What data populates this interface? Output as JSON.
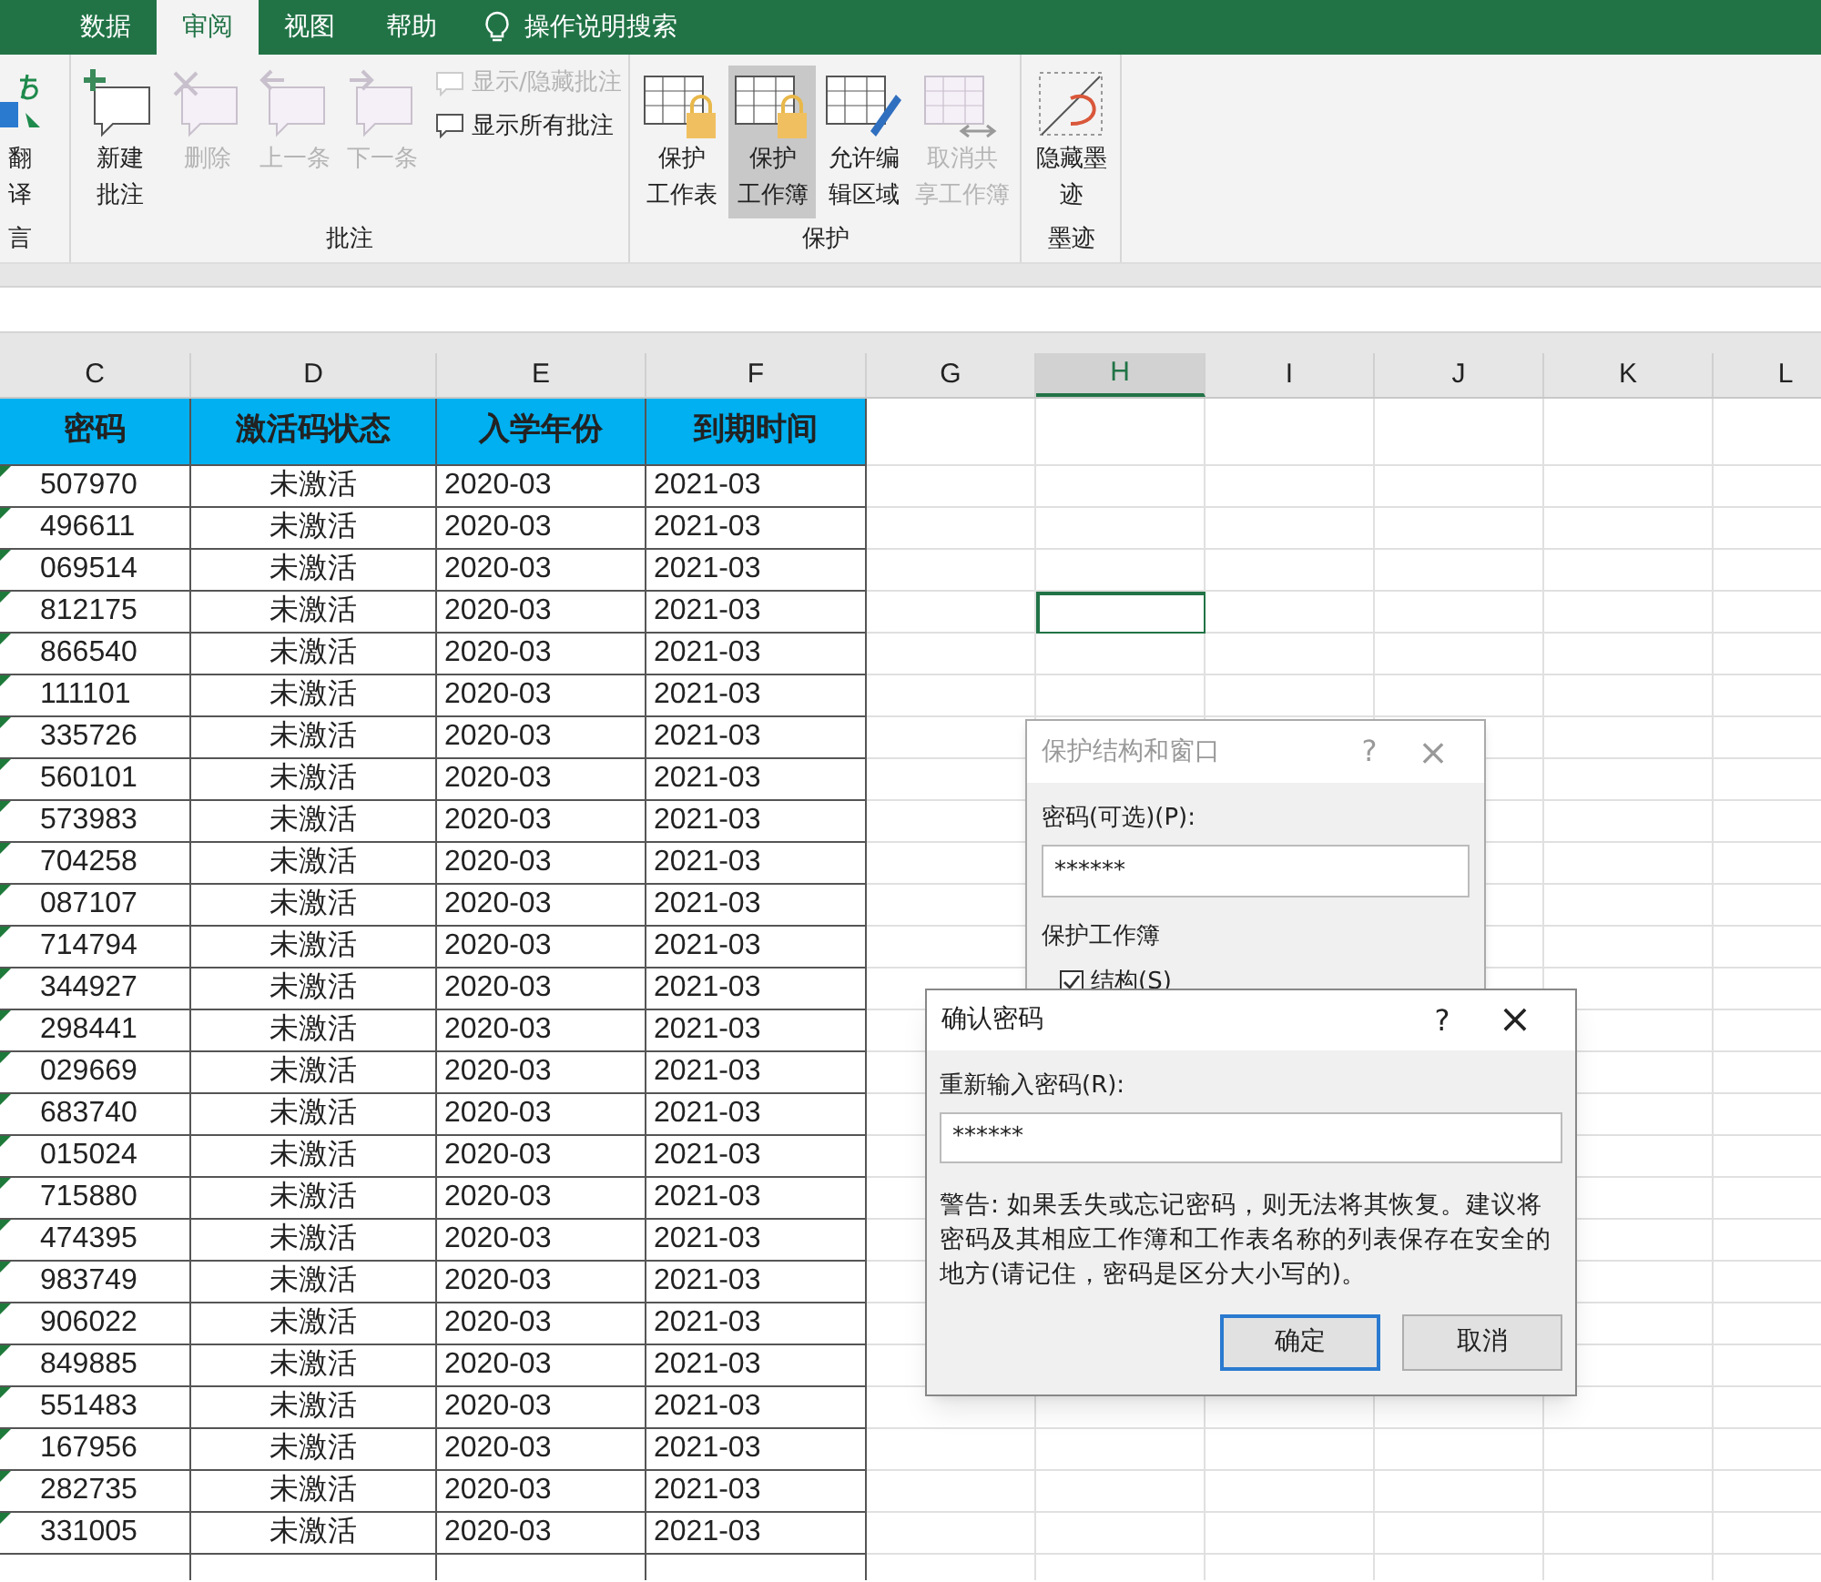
{
  "tabs": [
    {
      "label": "数据",
      "selected": false
    },
    {
      "label": "审阅",
      "selected": true
    },
    {
      "label": "视图",
      "selected": false
    },
    {
      "label": "帮助",
      "selected": false
    }
  ],
  "search": {
    "placeholder": "操作说明搜索"
  },
  "ribbon": {
    "groups": [
      {
        "label": "言",
        "buttons": [
          {
            "kind": "translate",
            "lines": [
              "翻",
              "译"
            ],
            "disabled": false,
            "selected": false
          }
        ]
      },
      {
        "label": "批注",
        "buttons": [
          {
            "kind": "new-comment",
            "lines": [
              "新建",
              "批注"
            ],
            "disabled": false,
            "selected": false
          },
          {
            "kind": "delete-comment",
            "lines": [
              "删除"
            ],
            "disabled": true,
            "selected": false
          },
          {
            "kind": "prev-comment",
            "lines": [
              "上一条"
            ],
            "disabled": true,
            "selected": false
          },
          {
            "kind": "next-comment",
            "lines": [
              "下一条"
            ],
            "disabled": true,
            "selected": false
          }
        ],
        "small_buttons": [
          {
            "label": "显示/隐藏批注",
            "disabled": true
          },
          {
            "label": "显示所有批注",
            "disabled": false
          }
        ]
      },
      {
        "label": "保护",
        "buttons": [
          {
            "kind": "protect-sheet",
            "lines": [
              "保护",
              "工作表"
            ],
            "disabled": false,
            "selected": false
          },
          {
            "kind": "protect-workbook",
            "lines": [
              "保护",
              "工作簿"
            ],
            "disabled": false,
            "selected": true
          },
          {
            "kind": "allow-edit",
            "lines": [
              "允许编",
              "辑区域"
            ],
            "disabled": false,
            "selected": false
          },
          {
            "kind": "unshare",
            "lines": [
              "取消共",
              "享工作簿"
            ],
            "disabled": true,
            "selected": false
          }
        ]
      },
      {
        "label": "墨迹",
        "buttons": [
          {
            "kind": "hide-ink",
            "lines": [
              "隐藏墨",
              "迹"
            ],
            "disabled": false,
            "selected": false
          }
        ]
      }
    ]
  },
  "columns": [
    {
      "label": "C",
      "selected": false
    },
    {
      "label": "D",
      "selected": false
    },
    {
      "label": "E",
      "selected": false
    },
    {
      "label": "F",
      "selected": false
    },
    {
      "label": "G",
      "selected": false
    },
    {
      "label": "H",
      "selected": true
    },
    {
      "label": "I",
      "selected": false
    },
    {
      "label": "J",
      "selected": false
    },
    {
      "label": "K",
      "selected": false
    },
    {
      "label": "L",
      "selected": false
    }
  ],
  "table": {
    "headers": [
      "密码",
      "激活码状态",
      "入学年份",
      "到期时间"
    ],
    "rows": [
      {
        "cells": [
          "507970",
          "未激活",
          "2020-03",
          "2021-03"
        ]
      },
      {
        "cells": [
          "496611",
          "未激活",
          "2020-03",
          "2021-03"
        ]
      },
      {
        "cells": [
          "069514",
          "未激活",
          "2020-03",
          "2021-03"
        ]
      },
      {
        "cells": [
          "812175",
          "未激活",
          "2020-03",
          "2021-03"
        ],
        "active": true
      },
      {
        "cells": [
          "866540",
          "未激活",
          "2020-03",
          "2021-03"
        ]
      },
      {
        "cells": [
          "111101",
          "未激活",
          "2020-03",
          "2021-03"
        ]
      },
      {
        "cells": [
          "335726",
          "未激活",
          "2020-03",
          "2021-03"
        ]
      },
      {
        "cells": [
          "560101",
          "未激活",
          "2020-03",
          "2021-03"
        ]
      },
      {
        "cells": [
          "573983",
          "未激活",
          "2020-03",
          "2021-03"
        ]
      },
      {
        "cells": [
          "704258",
          "未激活",
          "2020-03",
          "2021-03"
        ]
      },
      {
        "cells": [
          "087107",
          "未激活",
          "2020-03",
          "2021-03"
        ]
      },
      {
        "cells": [
          "714794",
          "未激活",
          "2020-03",
          "2021-03"
        ]
      },
      {
        "cells": [
          "344927",
          "未激活",
          "2020-03",
          "2021-03"
        ]
      },
      {
        "cells": [
          "298441",
          "未激活",
          "2020-03",
          "2021-03"
        ]
      },
      {
        "cells": [
          "029669",
          "未激活",
          "2020-03",
          "2021-03"
        ]
      },
      {
        "cells": [
          "683740",
          "未激活",
          "2020-03",
          "2021-03"
        ]
      },
      {
        "cells": [
          "015024",
          "未激活",
          "2020-03",
          "2021-03"
        ]
      },
      {
        "cells": [
          "715880",
          "未激活",
          "2020-03",
          "2021-03"
        ]
      },
      {
        "cells": [
          "474395",
          "未激活",
          "2020-03",
          "2021-03"
        ]
      },
      {
        "cells": [
          "983749",
          "未激活",
          "2020-03",
          "2021-03"
        ]
      },
      {
        "cells": [
          "906022",
          "未激活",
          "2020-03",
          "2021-03"
        ]
      },
      {
        "cells": [
          "849885",
          "未激活",
          "2020-03",
          "2021-03"
        ]
      },
      {
        "cells": [
          "551483",
          "未激活",
          "2020-03",
          "2021-03"
        ]
      },
      {
        "cells": [
          "167956",
          "未激活",
          "2020-03",
          "2021-03"
        ]
      },
      {
        "cells": [
          "282735",
          "未激活",
          "2020-03",
          "2021-03"
        ]
      },
      {
        "cells": [
          "331005",
          "未激活",
          "2020-03",
          "2021-03"
        ]
      }
    ]
  },
  "protect_dialog": {
    "title": "保护结构和窗口",
    "help": "?",
    "close": "×",
    "password_label": "密码(可选)(P):",
    "password": "******",
    "section": "保护工作簿",
    "checkbox": {
      "label": "结构(S)",
      "checked": true
    }
  },
  "confirm_dialog": {
    "title": "确认密码",
    "help": "?",
    "close": "×",
    "label": "重新输入密码(R):",
    "password": "******",
    "warning": "警告: 如果丢失或忘记密码，则无法将其恢复。建议将密码及其相应工作簿和工作表名称的列表保存在安全的地方(请记住，密码是区分大小写的)。",
    "buttons": [
      {
        "label": "确定",
        "kind": "default"
      },
      {
        "label": "取消",
        "kind": "normal"
      }
    ]
  }
}
